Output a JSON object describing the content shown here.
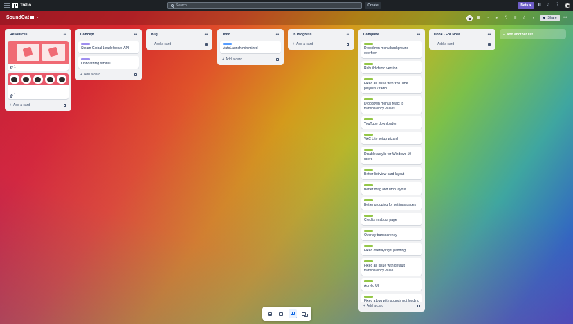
{
  "nav": {
    "product_name": "Trello",
    "search_placeholder": "Search",
    "create_label": "Create",
    "beta_label": "Beta"
  },
  "board": {
    "title": "SoundCat",
    "share_label": "Share",
    "add_list_label": "Add another list"
  },
  "lists": {
    "resources": {
      "title": "Resources",
      "cards": [
        {
          "type": "images",
          "attachments": "1"
        },
        {
          "type": "stickers",
          "attachments": "1"
        }
      ],
      "add_card": "Add a card"
    },
    "concept": {
      "title": "Concept",
      "cards": [
        {
          "title": "Steam Global Leaderboard API",
          "label_color": "#9f8fef"
        },
        {
          "title": "Onboarding tutorial",
          "label_color": "#9f8fef"
        }
      ],
      "add_card": "Add a card"
    },
    "bug": {
      "title": "Bug",
      "add_card": "Add a card"
    },
    "todo": {
      "title": "Todo",
      "cards": [
        {
          "title": "AutoLaunch minimized",
          "label_color": "#579dff"
        }
      ],
      "add_card": "Add a card"
    },
    "in_progress": {
      "title": "In Progress",
      "add_card": "Add a card"
    },
    "complete": {
      "title": "Complete",
      "label_color": "#94c748",
      "cards": [
        "Dropdown menu background overflow",
        "Rebuild demo version",
        "Fixed an issue with YouTube playlists / radio",
        "Dropdown menus react to transparency values",
        "YouTube downloader",
        "VAC Lite setup wizard",
        "Disable acrylic for Windows 10 users",
        "Better list view card layout",
        "Better drag and drop layout",
        "Better grouping for settings pages",
        "Credits in about page",
        "Overlay transparency",
        "Fixed overlay right padding",
        "Fixed an issue with default transparency value",
        "Acrylic UI",
        "Fixed a bug with sounds not loading in overlay"
      ],
      "add_card": "Add a card"
    },
    "done": {
      "title": "Done - For Now",
      "add_card": "Add a card"
    }
  },
  "colors": {
    "nav_bg": "#1d2125",
    "list_bg": "#f1f2f4",
    "beta_purple": "#6e5dc6",
    "complete_label": "#94c748",
    "concept_label": "#9f8fef",
    "todo_label": "#579dff"
  },
  "icons": {
    "apps": "apps-grid-icon",
    "search": "search-icon",
    "notifications": "bell-icon",
    "help": "help-icon",
    "feedback": "megaphone-icon",
    "filter": "filter-icon",
    "star": "star-icon",
    "power_ups": "rocket-icon",
    "automation": "lightning-icon"
  }
}
